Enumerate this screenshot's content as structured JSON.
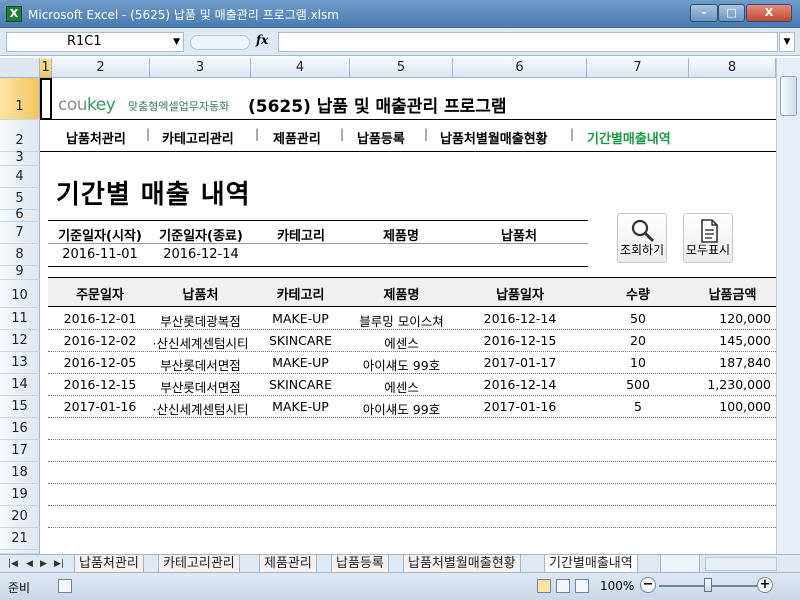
{
  "window": {
    "title": "Microsoft Excel - (5625) 납품 및 매출관리 프로그램.xlsm",
    "app_icon_letter": "X",
    "btn_minimize": "–",
    "btn_restore": "□",
    "btn_close": "X"
  },
  "formula_bar": {
    "name_box": "R1C1",
    "fx": "fx",
    "formula": ""
  },
  "grid": {
    "col_headers": [
      "1",
      "2",
      "3",
      "4",
      "5",
      "6",
      "7",
      "8"
    ],
    "row_headers": [
      "1",
      "2",
      "3",
      "4",
      "5",
      "6",
      "7",
      "8",
      "9",
      "10",
      "11",
      "12",
      "13",
      "14",
      "15",
      "16",
      "17",
      "18",
      "19",
      "20",
      "21"
    ]
  },
  "header": {
    "logo": "coukey",
    "logo_sub": "맞춤형엑셀업무자동화",
    "app_title": "(5625) 납품 및 매출관리 프로그램"
  },
  "nav": {
    "items": [
      "납품처관리",
      "카테고리관리",
      "제품관리",
      "납품등록",
      "납품처별월매출현황",
      "기간별매출내역"
    ],
    "separator": "|",
    "active_color": "#1e9a48"
  },
  "page_title": "기간별 매출 내역",
  "filter": {
    "headers": [
      "기준일자(시작)",
      "기준일자(종료)",
      "카테고리",
      "제품명",
      "납품처"
    ],
    "values": [
      "2016-11-01",
      "2016-12-14",
      "",
      "",
      ""
    ]
  },
  "buttons": {
    "search": "조회하기",
    "show_all": "모두표시"
  },
  "table": {
    "columns": [
      "주문일자",
      "납품처",
      "카테고리",
      "제품명",
      "납품일자",
      "수량",
      "납품금액"
    ],
    "rows": [
      [
        "2016-12-01",
        "부산롯데광복점",
        "MAKE-UP",
        "블루밍 모이스쳐",
        "2016-12-14",
        "50",
        "120,000"
      ],
      [
        "2016-12-02",
        "·산신세계센텀시티",
        "SKINCARE",
        "에센스",
        "2016-12-15",
        "20",
        "145,000"
      ],
      [
        "2016-12-05",
        "부산롯데서면점",
        "MAKE-UP",
        "아이섀도 99호",
        "2017-01-17",
        "10",
        "187,840"
      ],
      [
        "2016-12-15",
        "부산롯데서면점",
        "SKINCARE",
        "에센스",
        "2016-12-14",
        "500",
        "1,230,000"
      ],
      [
        "2017-01-16",
        "·산신세계센텀시티",
        "MAKE-UP",
        "아이섀도 99호",
        "2017-01-16",
        "5",
        "100,000"
      ]
    ]
  },
  "sheet_tabs": {
    "nav_arrows": [
      "|◀",
      "◀",
      "▶",
      "▶|"
    ],
    "tabs": [
      "납품처관리",
      "카테고리관리",
      "제품관리",
      "납품등록",
      "납품처별월매출현황",
      "기간별매출내역"
    ],
    "active": "기간별매출내역"
  },
  "status_bar": {
    "status": "준비",
    "zoom": "100%",
    "zoom_minus": "−",
    "zoom_plus": "+"
  }
}
